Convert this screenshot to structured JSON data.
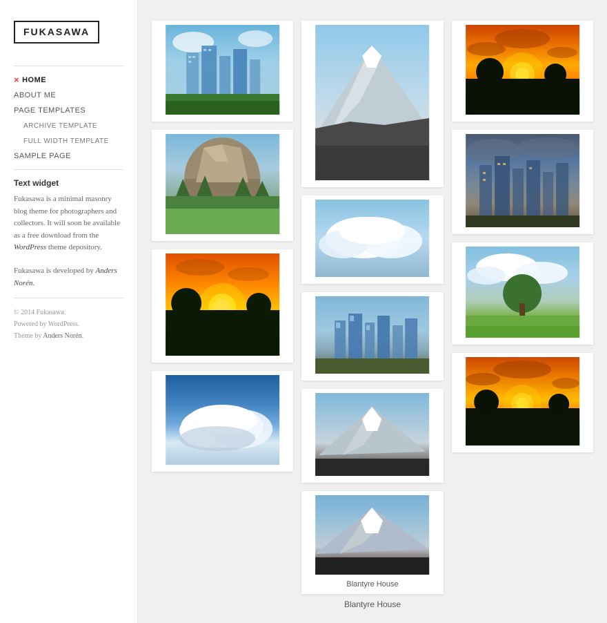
{
  "logo": "FUKASAWA",
  "nav": {
    "items": [
      {
        "label": "HOME",
        "active": true,
        "current": true
      },
      {
        "label": "ABOUT ME",
        "active": false
      },
      {
        "label": "PAGE TEMPLATES",
        "active": false
      },
      {
        "label": "ARCHIVE TEMPLATE",
        "sub": true,
        "active": false
      },
      {
        "label": "FULL WIDTH TEMPLATE",
        "sub": true,
        "active": false
      },
      {
        "label": "SAMPLE PAGE",
        "active": false
      }
    ]
  },
  "widget": {
    "title": "Text widget",
    "text1": "Fukasawa is a minimal masonry blog theme for photographers and collectors. It will soon be available as a free download from the ",
    "link1": "WordPress",
    "text2": " theme depository.",
    "text3": "Fukasawa is developed by ",
    "link2": "Anders Norén",
    "text4": "."
  },
  "footer": {
    "copyright": "© 2014 Fukasawa.",
    "line2": "Powered by WordPress.",
    "line3": "Theme by Anders Norén."
  },
  "photos": {
    "col1": [
      {
        "type": "skyscrapers-1",
        "caption": ""
      },
      {
        "type": "yosemite",
        "caption": ""
      },
      {
        "type": "sunset-1",
        "caption": ""
      },
      {
        "type": "clouds-bottom",
        "caption": ""
      }
    ],
    "col2": [
      {
        "type": "mountain",
        "caption": ""
      },
      {
        "type": "clouds-small",
        "caption": ""
      },
      {
        "type": "skyscrapers-2",
        "caption": ""
      },
      {
        "type": "mountain-bottom",
        "caption": ""
      },
      {
        "type": "mountain-bottom2",
        "caption": "Blantyre House"
      }
    ],
    "col3": [
      {
        "type": "sunset-2-top",
        "caption": ""
      },
      {
        "type": "skyscrapers-sunset",
        "caption": ""
      },
      {
        "type": "meadow",
        "caption": ""
      },
      {
        "type": "sunset-2",
        "caption": ""
      }
    ]
  }
}
